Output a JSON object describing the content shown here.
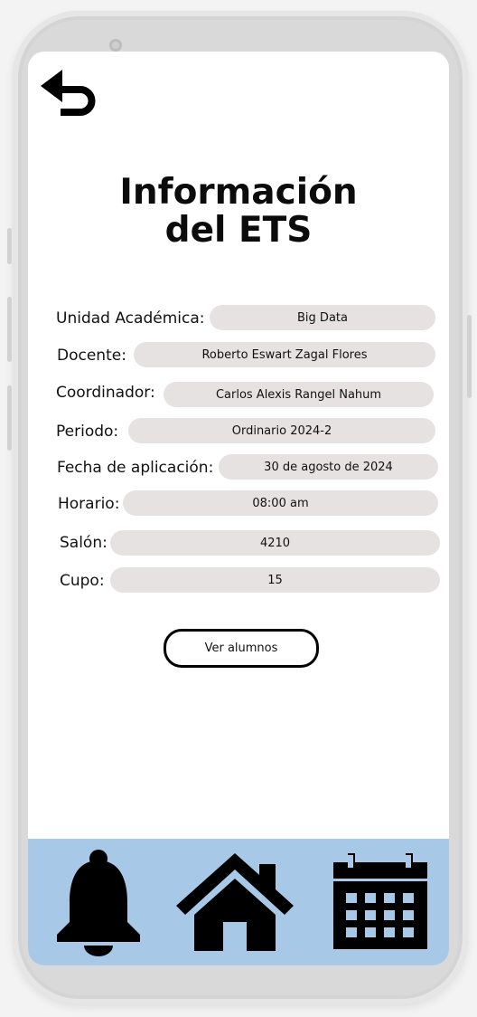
{
  "header": {
    "back_icon": "undo-arrow-icon",
    "title_line1": "Información",
    "title_line2": "del ETS"
  },
  "fields": [
    {
      "label": "Unidad Académica:",
      "value": "Big Data"
    },
    {
      "label": "Docente:",
      "value": "Roberto Eswart Zagal Flores"
    },
    {
      "label": "Coordinador:",
      "value": "Carlos Alexis Rangel Nahum"
    },
    {
      "label": "Periodo:",
      "value": "Ordinario 2024-2"
    },
    {
      "label": "Fecha de aplicación:",
      "value": "30 de agosto de 2024"
    },
    {
      "label": "Horario:",
      "value": "08:00 am"
    },
    {
      "label": "Salón:",
      "value": "4210"
    },
    {
      "label": "Cupo:",
      "value": "15"
    }
  ],
  "actions": {
    "ver_alumnos_label": "Ver alumnos"
  },
  "bottom_nav": {
    "background_color": "#a8c8e8",
    "items": [
      {
        "icon": "bell-icon"
      },
      {
        "icon": "home-icon"
      },
      {
        "icon": "calendar-icon"
      }
    ]
  }
}
